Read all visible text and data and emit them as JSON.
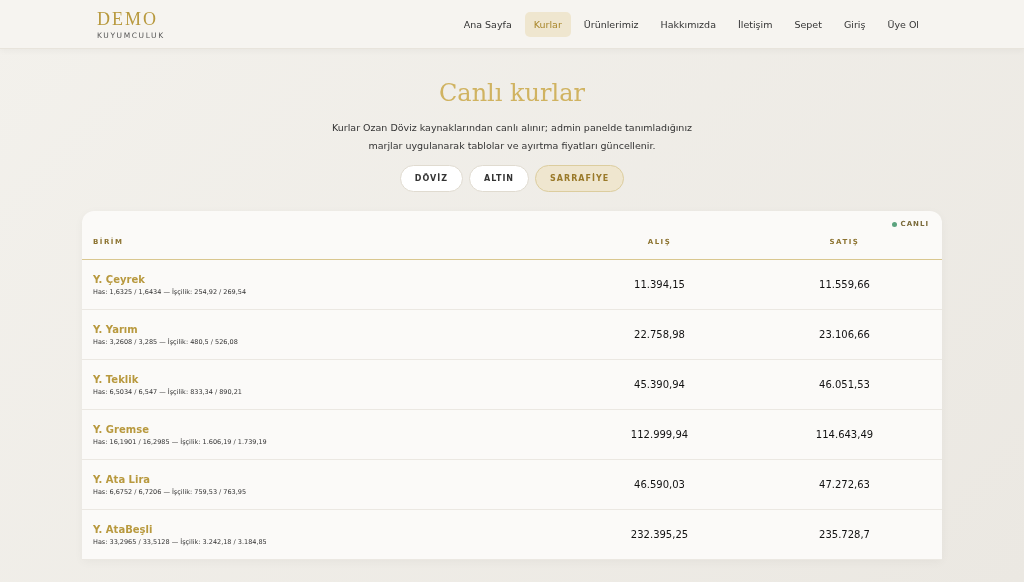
{
  "logo": {
    "name": "DEMO",
    "tagline": "KUYUMCULUK"
  },
  "nav": [
    {
      "label": "Ana Sayfa",
      "selected": false
    },
    {
      "label": "Kurlar",
      "selected": true
    },
    {
      "label": "Ürünlerimiz",
      "selected": false
    },
    {
      "label": "Hakkımızda",
      "selected": false
    },
    {
      "label": "İletişim",
      "selected": false
    },
    {
      "label": "Sepet",
      "selected": false
    },
    {
      "label": "Giriş",
      "selected": false
    },
    {
      "label": "Üye Ol",
      "selected": false
    }
  ],
  "title": "Canlı kurlar",
  "intro": "Kurlar Ozan Döviz kaynaklarından canlı alınır; admin panelde tanımladığınız marjlar uygulanarak tablolar ve ayırtma fiyatları güncellenir.",
  "filters": [
    {
      "label": "DÖVİZ",
      "selected": false
    },
    {
      "label": "ALTIN",
      "selected": false
    },
    {
      "label": "SARRAFİYE",
      "selected": true
    }
  ],
  "live_badge": {
    "label": "CANLI",
    "on": true
  },
  "table": {
    "columns": [
      "BİRİM",
      "ALIŞ",
      "SATIŞ"
    ],
    "rows": [
      {
        "name": "Y. Çeyrek",
        "detail": "Has: 1,6325 / 1,6434 — İşçilik: 254,92 / 269,54",
        "buy": "11.394,15",
        "sell": "11.559,66"
      },
      {
        "name": "Y. Yarım",
        "detail": "Has: 3,2608 / 3,285 — İşçilik: 480,5 / 526,08",
        "buy": "22.758,98",
        "sell": "23.106,66"
      },
      {
        "name": "Y. Teklik",
        "detail": "Has: 6,5034 / 6,547 — İşçilik: 833,34 / 890,21",
        "buy": "45.390,94",
        "sell": "46.051,53"
      },
      {
        "name": "Y. Gremse",
        "detail": "Has: 16,1901 / 16,2985 — İşçilik: 1.606,19 / 1.739,19",
        "buy": "112.999,94",
        "sell": "114.643,49"
      },
      {
        "name": "Y. Ata Lira",
        "detail": "Has: 6,6752 / 6,7206 — İşçilik: 759,53 / 763,95",
        "buy": "46.590,03",
        "sell": "47.272,63"
      },
      {
        "name": "Y. AtaBeşli",
        "detail": "Has: 33,2965 / 33,5128 — İşçilik: 3.242,18 / 3.184,85",
        "buy": "232.395,25",
        "sell": "235.728,7"
      }
    ]
  }
}
